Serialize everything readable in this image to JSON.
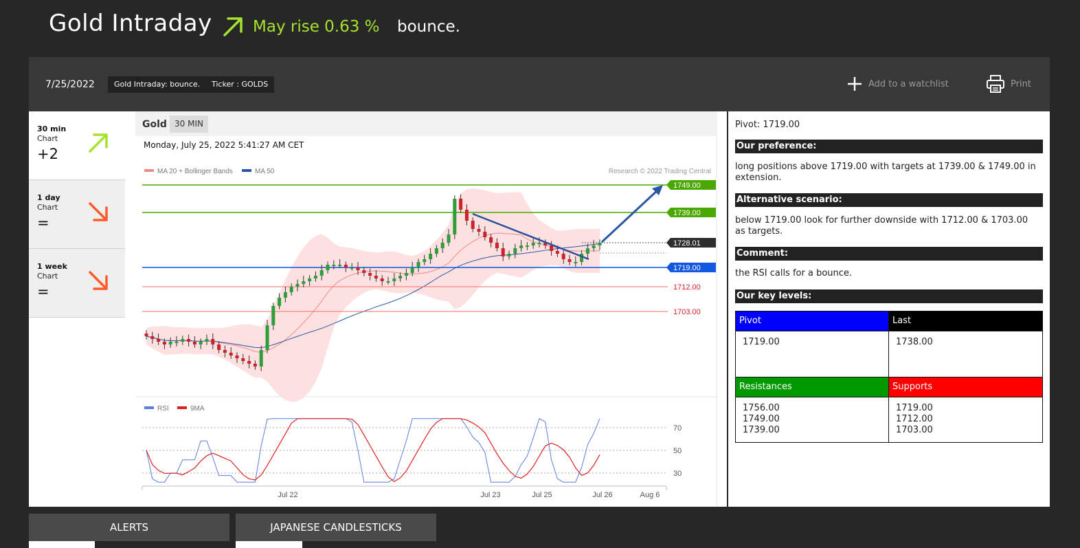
{
  "header": {
    "title": "Gold Intraday",
    "forecast": "May rise 0.63 %",
    "headline": "bounce.",
    "trend_icon": "arrow-up-right-icon",
    "forecast_color": "#a6e22e"
  },
  "info_bar": {
    "date": "7/25/2022",
    "title_chip": "Gold Intraday: bounce.",
    "ticker_chip": "Ticker : GOLDS",
    "watchlist_label": "Add to a watchlist",
    "print_label": "Print"
  },
  "timeframes": [
    {
      "name": "30 min",
      "sub": "Chart",
      "score": "+2",
      "direction": "up",
      "icon": "arrow-up-right-icon",
      "color": "#a6e22e"
    },
    {
      "name": "1 day",
      "sub": "Chart",
      "score": "=",
      "direction": "down",
      "icon": "arrow-down-right-icon",
      "color": "#ff5a2a"
    },
    {
      "name": "1 week",
      "sub": "Chart",
      "score": "=",
      "direction": "down",
      "icon": "arrow-down-right-icon",
      "color": "#ff5a2a"
    }
  ],
  "chart": {
    "symbol": "Gold",
    "timeframe": "30 MIN",
    "timestamp": "Monday, July 25, 2022 5:41:27 AM CET",
    "legend_ma20": "MA 20 + Bollinger Bands",
    "legend_ma50": "MA 50",
    "copyright": "Research © 2022 Trading Central",
    "legend_rsi": "RSI",
    "legend_9ma": "9MA",
    "colors": {
      "up": "#2e9e3a",
      "down": "#d0202a",
      "ma50": "#2a56a6",
      "band": "#fde0e0",
      "resistance": "#4aa800",
      "pivot": "#1457e0",
      "support": "#ff6a6a"
    }
  },
  "chart_data": {
    "type": "candlestick",
    "levels": [
      {
        "label": "1749.00",
        "value": 1749.0,
        "kind": "resistance"
      },
      {
        "label": "1739.00",
        "value": 1739.0,
        "kind": "resistance"
      },
      {
        "label": "1728.01",
        "value": 1728.01,
        "kind": "last"
      },
      {
        "label": "1719.00",
        "value": 1719.0,
        "kind": "pivot"
      },
      {
        "label": "1712.00",
        "value": 1712.0,
        "kind": "support"
      },
      {
        "label": "1703.00",
        "value": 1703.0,
        "kind": "support"
      }
    ],
    "x_labels": [
      "Jul 22",
      "Jul 23",
      "Jul 25",
      "Jul 26",
      "Aug 6"
    ],
    "rsi_levels": [
      "70",
      "50",
      "30"
    ],
    "closes": [
      1694,
      1693,
      1692,
      1691,
      1692,
      1692,
      1693,
      1692,
      1691,
      1692,
      1693,
      1691,
      1689,
      1688,
      1687,
      1686,
      1685,
      1684,
      1683,
      1689,
      1698,
      1705,
      1708,
      1710,
      1712,
      1713,
      1714,
      1715,
      1716,
      1718,
      1720,
      1720,
      1720,
      1719,
      1719,
      1718,
      1717,
      1716,
      1715,
      1714,
      1714,
      1715,
      1716,
      1717,
      1719,
      1721,
      1722,
      1724,
      1726,
      1728,
      1731,
      1744,
      1740,
      1736,
      1733,
      1732,
      1730,
      1728,
      1726,
      1723,
      1724,
      1726,
      1727,
      1727,
      1728,
      1728,
      1727,
      1725,
      1724,
      1722,
      1721,
      1721,
      1724,
      1726,
      1727,
      1728
    ]
  },
  "analysis": {
    "pivot_text": "Pivot: 1719.00",
    "preference_head": "Our preference:",
    "preference_body": "long positions above 1719.00 with targets at 1739.00 & 1749.00 in extension.",
    "alternative_head": "Alternative scenario:",
    "alternative_body": "below 1719.00 look for further downside with 1712.00 & 1703.00 as targets.",
    "comment_head": "Comment:",
    "comment_body": "the RSI calls for a bounce.",
    "levels_head": "Our key levels:",
    "pivot_label": "Pivot",
    "pivot_value": "1719.00",
    "last_label": "Last",
    "last_value": "1738.00",
    "resistances_label": "Resistances",
    "resistances_value": "1756.00\n1749.00\n1739.00",
    "supports_label": "Supports",
    "supports_value": "1719.00\n1712.00\n1703.00"
  },
  "tabs": [
    {
      "label": "ALERTS"
    },
    {
      "label": "JAPANESE CANDLESTICKS"
    }
  ]
}
